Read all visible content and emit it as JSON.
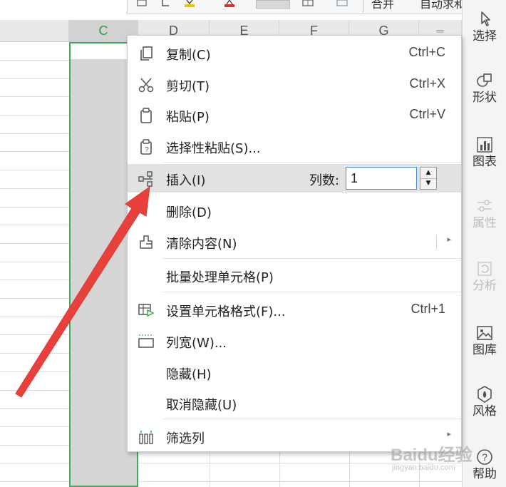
{
  "toolbar": {
    "item1": "合并",
    "item2": "自动求和"
  },
  "columns": [
    "C",
    "D",
    "E",
    "F",
    "G"
  ],
  "selected_column": "C",
  "menu": {
    "copy": {
      "label": "复制(C)",
      "shortcut": "Ctrl+C"
    },
    "cut": {
      "label": "剪切(T)",
      "shortcut": "Ctrl+X"
    },
    "paste": {
      "label": "粘贴(P)",
      "shortcut": "Ctrl+V"
    },
    "paste_special": {
      "label": "选择性粘贴(S)..."
    },
    "insert": {
      "label": "插入(I)",
      "count_label": "列数:",
      "count_value": "1"
    },
    "delete": {
      "label": "删除(D)"
    },
    "clear": {
      "label": "清除内容(N)"
    },
    "batch": {
      "label": "批量处理单元格(P)"
    },
    "format": {
      "label": "设置单元格格式(F)...",
      "shortcut": "Ctrl+1"
    },
    "col_width": {
      "label": "列宽(W)..."
    },
    "hide": {
      "label": "隐藏(H)"
    },
    "unhide": {
      "label": "取消隐藏(U)"
    },
    "filter_col": {
      "label": "筛选列"
    }
  },
  "right_panel": [
    {
      "label": "选择",
      "icon": "cursor-icon",
      "enabled": true
    },
    {
      "label": "形状",
      "icon": "shapes-icon",
      "enabled": true
    },
    {
      "label": "图表",
      "icon": "chart-icon",
      "enabled": true
    },
    {
      "label": "属性",
      "icon": "sliders-icon",
      "enabled": false
    },
    {
      "label": "分析",
      "icon": "analyze-icon",
      "enabled": false
    },
    {
      "label": "图库",
      "icon": "gallery-icon",
      "enabled": true
    },
    {
      "label": "风格",
      "icon": "style-icon",
      "enabled": true
    },
    {
      "label": "帮助",
      "icon": "help-icon",
      "enabled": true
    }
  ],
  "watermark": {
    "main": "Baidu经验",
    "sub": "jingyan.baidu.com"
  },
  "colors": {
    "selection_green": "#3fae57",
    "annotation_arrow": "#e8403a",
    "input_border": "#4a90d9"
  }
}
